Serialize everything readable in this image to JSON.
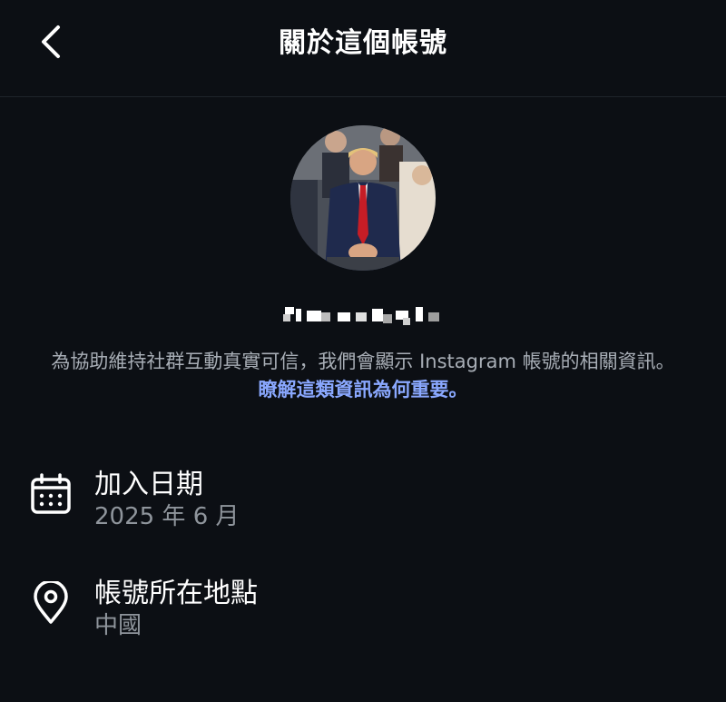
{
  "header": {
    "title": "關於這個帳號",
    "back_icon": "chevron-left-icon"
  },
  "profile": {
    "avatar_icon": "profile-photo",
    "username_display": "pixelated (obscured)"
  },
  "description": {
    "text": "為協助維持社群互動真實可信，我們會顯示 Instagram 帳號的相關資訊。",
    "link_text": "瞭解這類資訊為何重要。"
  },
  "details": {
    "join_date": {
      "icon": "calendar-icon",
      "label": "加入日期",
      "value": "2025 年 6 月"
    },
    "location": {
      "icon": "location-pin-icon",
      "label": "帳號所在地點",
      "value": "中國"
    }
  },
  "colors": {
    "background": "#0c0f14",
    "link": "#8aa8ff",
    "secondary_text": "#8f959c"
  }
}
